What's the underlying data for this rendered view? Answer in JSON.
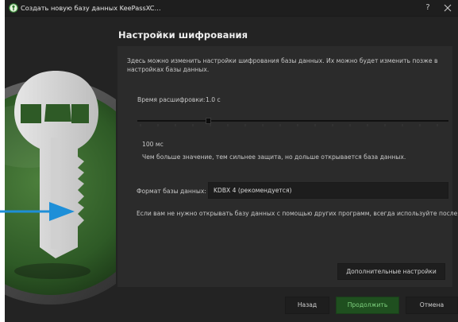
{
  "window": {
    "title": "Создать новую базу данных KeePassXC…",
    "help_label": "?"
  },
  "page": {
    "title": "Настройки шифрования",
    "description": "Здесь можно изменить настройки шифрования базы данных. Их можно будет изменить позже в настройках базы данных."
  },
  "decryption": {
    "label": "Время расшифровки:",
    "value": "1.0 с",
    "slider_fraction": 0.22,
    "min_label": "100 мс",
    "hint": "Чем больше значение, тем сильнее защита, но дольше открывается база данных."
  },
  "format": {
    "label": "Формат базы данных:",
    "value": "KDBX 4 (рекомендуется)"
  },
  "note": "Если вам не нужно открывать базу данных с помощью других программ, всегда используйте после,",
  "buttons": {
    "advanced": "Дополнительные настройки",
    "back": "Назад",
    "continue": "Продолжить",
    "cancel": "Отмена"
  },
  "colors": {
    "background": "#232323",
    "panel": "#2b2b2b",
    "accent_green": "#7fd37f",
    "arrow_blue": "#1e8fd8"
  },
  "icons": {
    "app": "keepassxc-logo-icon",
    "close": "close-icon",
    "art": "key-illustration"
  }
}
